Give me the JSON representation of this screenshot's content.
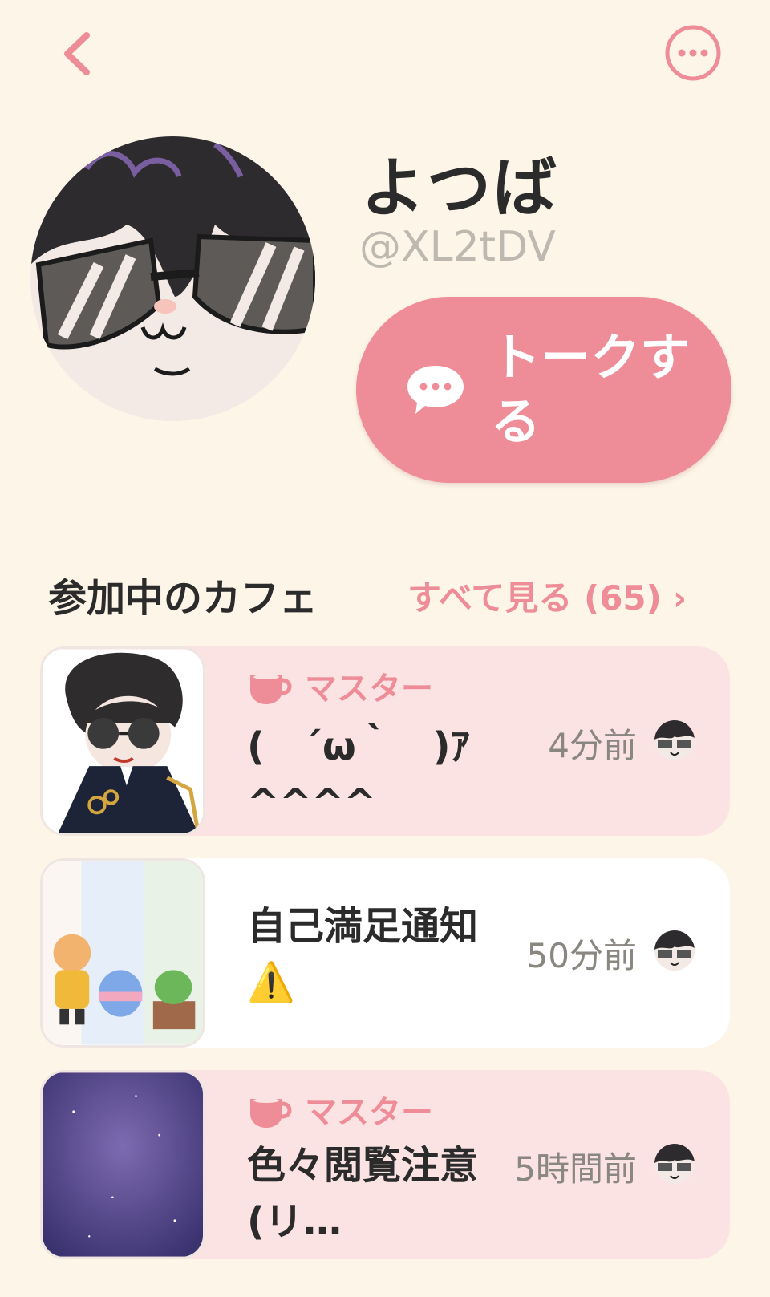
{
  "header": {
    "back_icon": "chevron-left-icon",
    "more_icon": "more-horizontal-icon",
    "accent": "#ee8c98"
  },
  "profile": {
    "name": "よつば",
    "handle": "@XL2tDV",
    "talk_button_label": "トークする",
    "talk_icon": "chat-bubble-icon"
  },
  "cafes_section": {
    "title": "参加中のカフェ",
    "see_all_label": "すべて見る (65)",
    "see_all_chevron": "›",
    "items": [
      {
        "role": "マスター",
        "title": "(　´ω｀　)ｱ^^^^",
        "time": "4分前"
      },
      {
        "role": "",
        "title": "自己満足通知⚠️",
        "time": "50分前"
      },
      {
        "role": "マスター",
        "title": "色々閲覧注意　(リ…",
        "time": "5時間前"
      }
    ]
  }
}
